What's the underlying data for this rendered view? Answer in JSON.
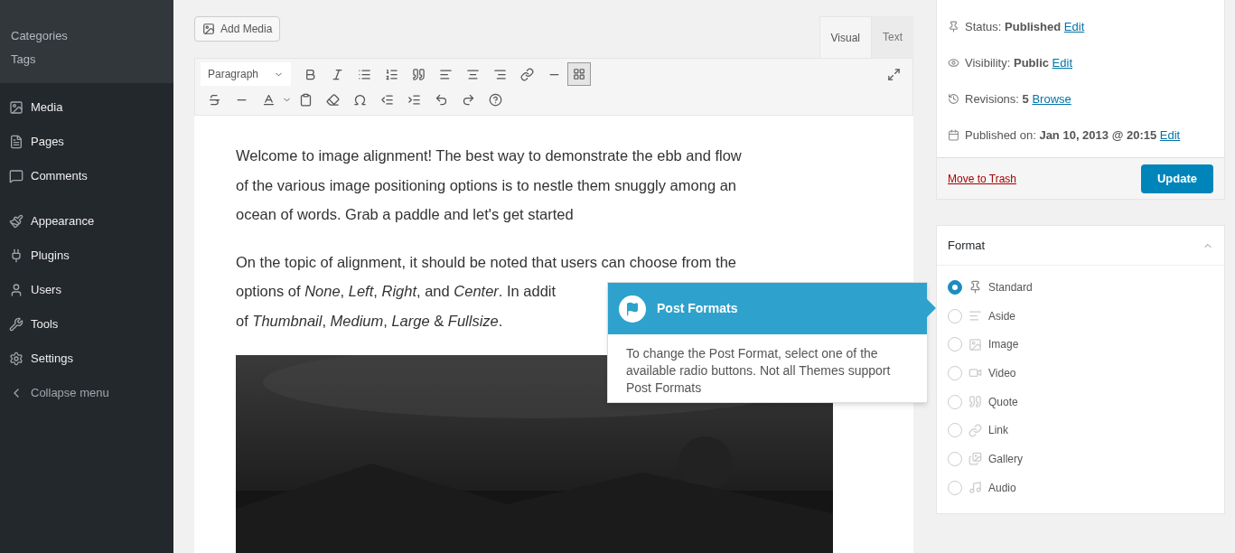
{
  "sidebar": {
    "submenu": [
      {
        "label": "Categories"
      },
      {
        "label": "Tags"
      }
    ],
    "items": [
      {
        "label": "Media",
        "kind": "menu"
      },
      {
        "label": "Pages",
        "kind": "menu"
      },
      {
        "label": "Comments",
        "kind": "menu"
      },
      {
        "label": "Appearance",
        "kind": "menu"
      },
      {
        "label": "Plugins",
        "kind": "menu"
      },
      {
        "label": "Users",
        "kind": "menu"
      },
      {
        "label": "Tools",
        "kind": "menu"
      },
      {
        "label": "Settings",
        "kind": "menu"
      },
      {
        "label": "Collapse menu",
        "kind": "collapse"
      }
    ]
  },
  "editor": {
    "add_media": "Add Media",
    "tabs": [
      {
        "label": "Visual",
        "selected": true
      },
      {
        "label": "Text",
        "selected": false
      }
    ],
    "block_format": "Paragraph",
    "paragraphs": [
      {
        "lines": [
          "Welcome to image alignment! The best way to demonstrate the ebb and flow",
          "of the various image positioning options is to nestle them snuggly among an",
          "ocean of words. Grab a paddle and let's get started"
        ]
      },
      {
        "lines": [
          "On the topic of alignment, it should be noted that users can choose from the",
          "options of *None*, *Left*, *Right*, and *Center*. In addit",
          "of *Thumbnail*, *Medium*, *Large* & *Fullsize*."
        ]
      }
    ]
  },
  "publish": {
    "rows": [
      {
        "label": "Status:",
        "value": "Published",
        "link": "Edit"
      },
      {
        "label": "Visibility:",
        "value": "Public",
        "link": "Edit"
      },
      {
        "label": "Revisions:",
        "value": "5",
        "link": "Browse"
      },
      {
        "label": "Published on:",
        "value": "Jan 10, 2013 @ 20:15",
        "link": "Edit"
      }
    ],
    "trash": "Move to Trash",
    "update": "Update"
  },
  "format": {
    "title": "Format",
    "options": [
      {
        "label": "Standard",
        "selected": true
      },
      {
        "label": "Aside",
        "selected": false
      },
      {
        "label": "Image",
        "selected": false
      },
      {
        "label": "Video",
        "selected": false
      },
      {
        "label": "Quote",
        "selected": false
      },
      {
        "label": "Link",
        "selected": false
      },
      {
        "label": "Gallery",
        "selected": false
      },
      {
        "label": "Audio",
        "selected": false
      }
    ]
  },
  "tooltip": {
    "title": "Post Formats",
    "body": "To change the Post Format, select one of the available radio buttons. Not all Themes support Post Formats"
  }
}
